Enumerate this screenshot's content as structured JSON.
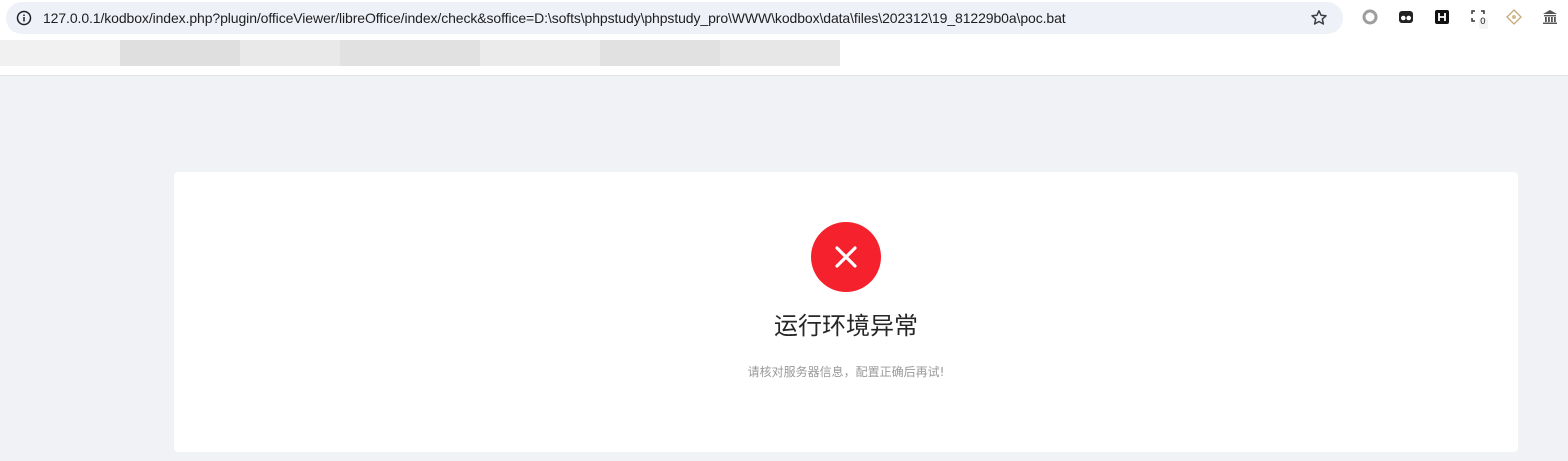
{
  "browser": {
    "url": "127.0.0.1/kodbox/index.php?plugin/officeViewer/libreOffice/index/check&soffice=D:\\softs\\phpstudy\\phpstudy_pro\\WWW\\kodbox\\data\\files\\202312\\19_81229b0a\\poc.bat",
    "site_info_icon": "info-icon",
    "bookmark_icon": "star-icon",
    "extensions": [
      {
        "name": "circle-extension-icon"
      },
      {
        "name": "glasses-extension-icon"
      },
      {
        "name": "h-extension-icon"
      },
      {
        "name": "scan-extension-icon",
        "badge": "0"
      },
      {
        "name": "diamond-extension-icon"
      },
      {
        "name": "building-extension-icon"
      }
    ]
  },
  "error_page": {
    "icon": "close-circle-icon",
    "icon_color": "#f5222d",
    "title": "运行环境异常",
    "subtitle": "请核对服务器信息，配置正确后再试!"
  }
}
